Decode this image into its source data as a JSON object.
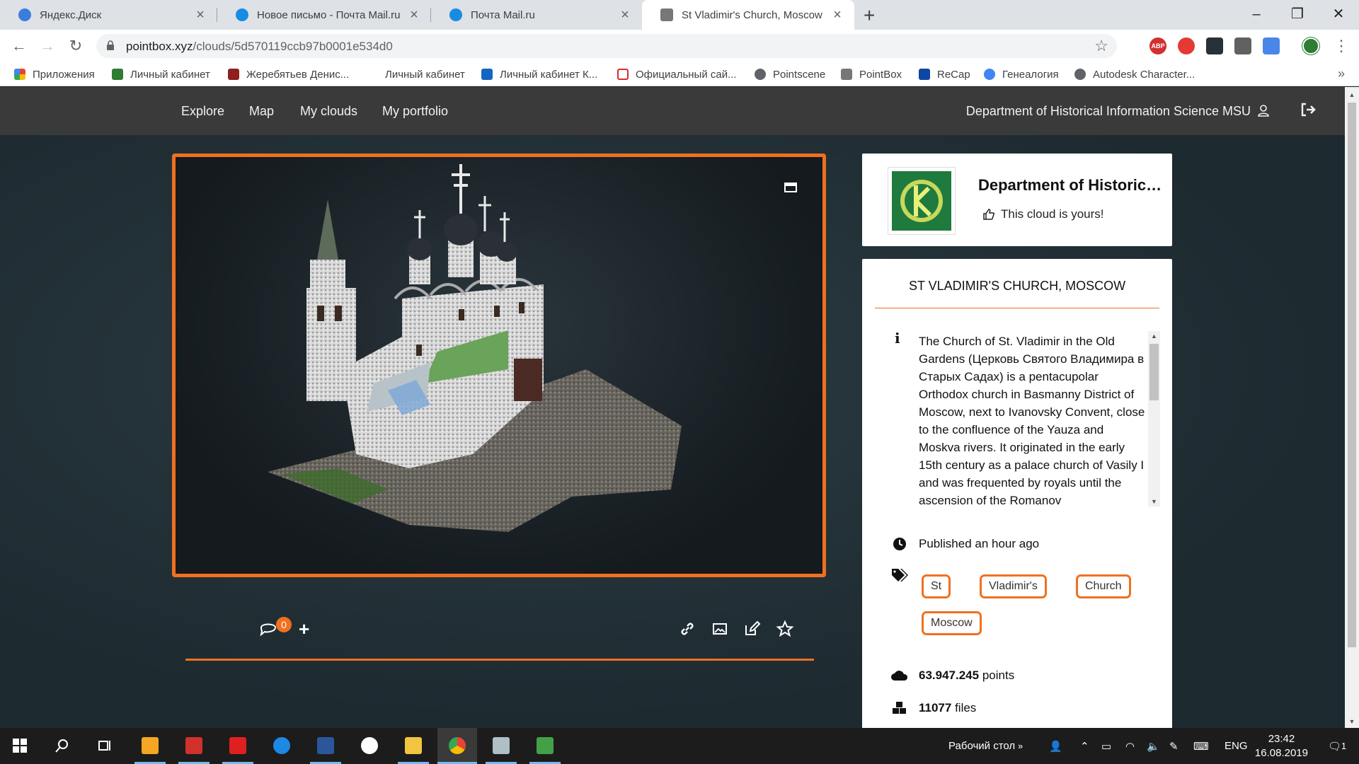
{
  "browser": {
    "tabs": [
      {
        "title": "Яндекс.Диск",
        "active": false
      },
      {
        "title": "Новое письмо - Почта Mail.ru",
        "active": false
      },
      {
        "title": "Почта Mail.ru",
        "active": false
      },
      {
        "title": "St Vladimir's Church, Moscow",
        "active": true
      }
    ],
    "url_host": "pointbox.xyz",
    "url_path": "/clouds/5d570119ccb97b0001e534d0",
    "extensions": [
      "ABP"
    ],
    "bookmarks": [
      "Приложения",
      "Личный кабинет",
      "Жеребятьев Денис...",
      "Личный кабинет",
      "Личный кабинет К...",
      "Официальный сай...",
      "Pointscene",
      "PointBox",
      "ReCap",
      "Генеалогия",
      "Autodesk Character..."
    ]
  },
  "site": {
    "nav": [
      "Explore",
      "Map",
      "My clouds",
      "My portfolio"
    ],
    "user": "Department of Historical Information Science MSU",
    "comment_count": "0",
    "owner": {
      "name": "Department of Historical Information Science MSU",
      "status": "This cloud is yours!"
    },
    "cloud": {
      "title": "ST VLADIMIR'S CHURCH, MOSCOW",
      "description": "The Church of St. Vladimir in the Old Gardens (Церковь Святого Владимира в Старых Садах) is a pentacupolar Orthodox church in Basmanny District of Moscow, next to Ivanovsky Convent, close to the confluence of the Yauza and Moskva rivers. It originated in the early 15th century as a palace church of Vasily I and was frequented by royals until the ascension of the Romanov",
      "published": "Published an hour ago",
      "tags": [
        "St",
        "Vladimir's",
        "Church",
        "Moscow"
      ],
      "points_value": "63.947.245",
      "points_label": "points",
      "files_value": "11077",
      "files_label": "files"
    }
  },
  "taskbar": {
    "desktop_label": "Рабочий стол",
    "lang": "ENG",
    "time": "23:42",
    "date": "16.08.2019",
    "notifications": "1"
  },
  "colors": {
    "accent": "#f07020",
    "navbar": "#3a3a3a",
    "background": "#1c2a30"
  }
}
